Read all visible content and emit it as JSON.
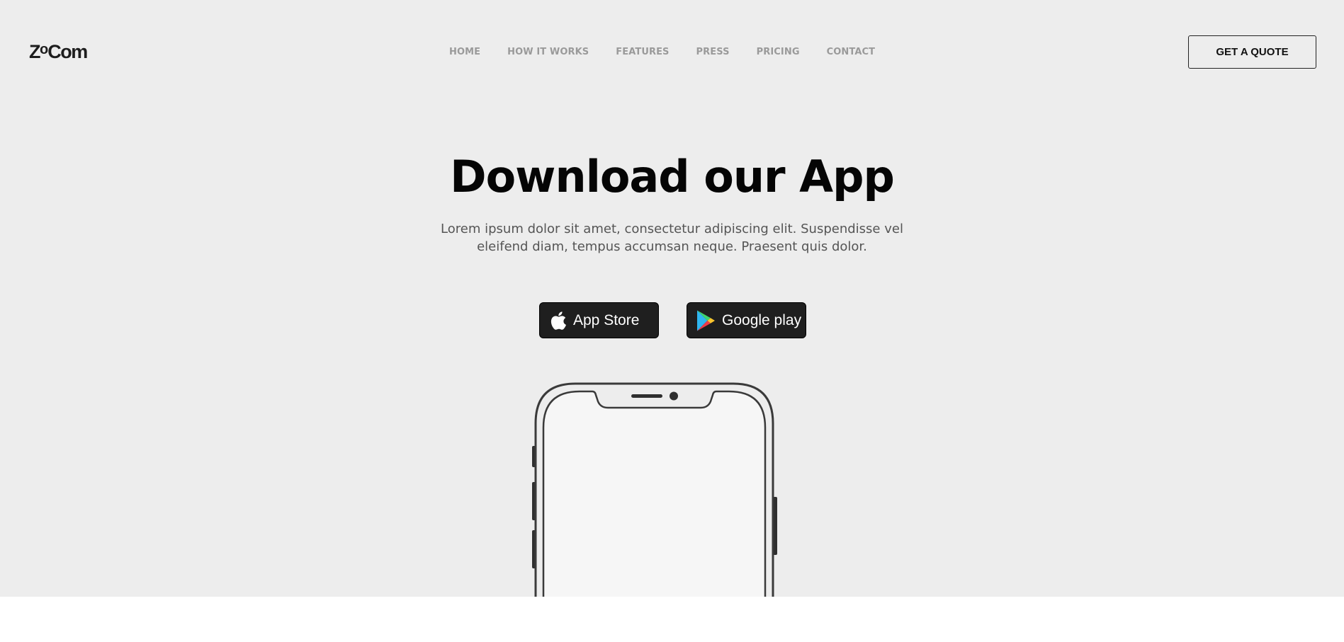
{
  "brand": {
    "name_prefix": "Z",
    "name_small": "o",
    "name_suffix": "Com"
  },
  "nav": {
    "items": [
      {
        "label": "HOME"
      },
      {
        "label": "HOW IT WORKS"
      },
      {
        "label": "FEATURES"
      },
      {
        "label": "PRESS"
      },
      {
        "label": "PRICING"
      },
      {
        "label": "CONTACT"
      }
    ]
  },
  "header": {
    "cta_label": "GET A QUOTE"
  },
  "hero": {
    "title": "Download our App",
    "subtitle": "Lorem ipsum dolor sit amet, consectetur adipiscing elit. Suspendisse vel eleifend diam, tempus accumsan neque. Praesent quis dolor.",
    "app_store_label": "App Store",
    "google_play_label": "Google play",
    "app_store_icon": "apple-icon",
    "google_play_icon": "google-play-icon"
  },
  "colors": {
    "hero_background": "#ededed",
    "page_background": "#ffffff",
    "store_button": "#1f1f1f",
    "nav_text": "#9a9a9a",
    "heading": "#050505"
  }
}
